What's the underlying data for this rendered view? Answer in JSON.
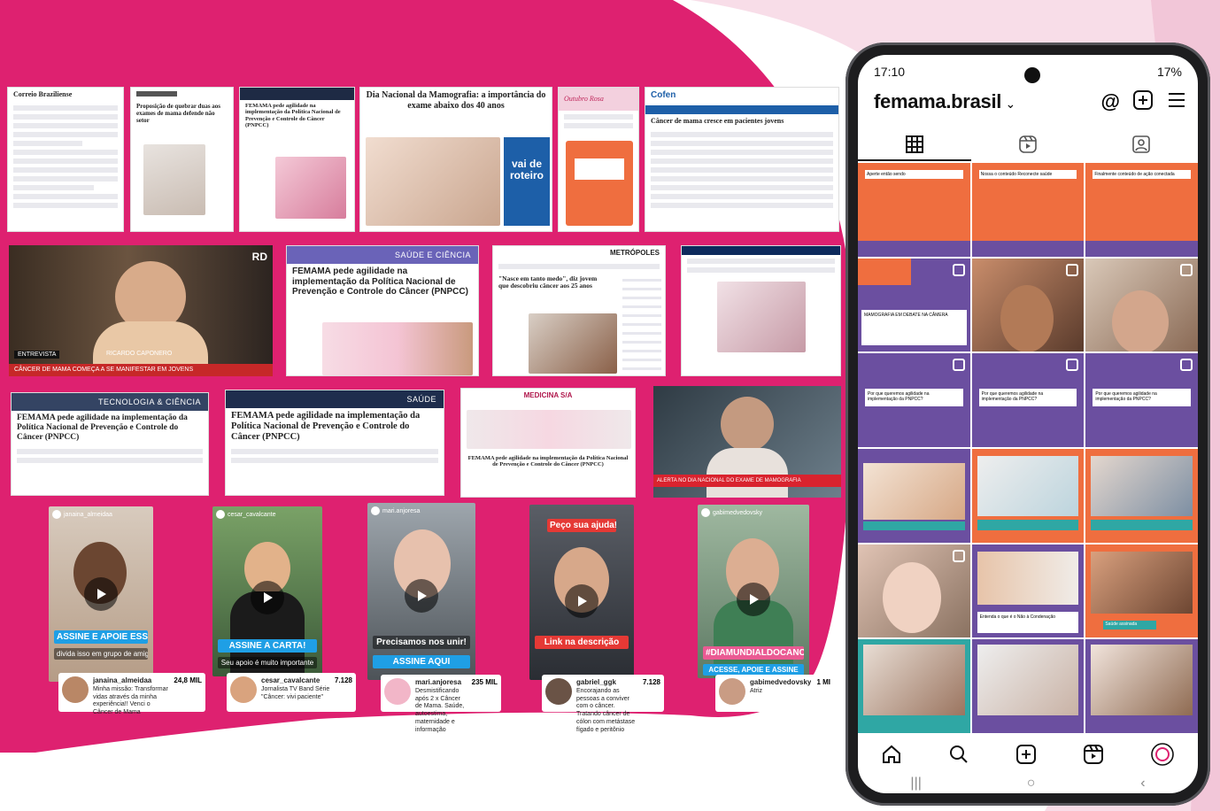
{
  "clips_top": {
    "c1_masthead": "Correio Braziliense",
    "c2_headline": "Proposição de quebrar duas aos exames de mama defende não setor",
    "c3_headline": "FEMAMA pede agilidade na implementação da Política Nacional de Prevenção e Controle do Câncer (PNPCC)",
    "c4_headline": "Dia Nacional da Mamografia: a importância do exame abaixo dos 40 anos",
    "c4_badge": "vai de roteiro",
    "c5_top": "Outubro Rosa",
    "c6_logo": "Cofen",
    "c6_headline": "Câncer de mama cresce em pacientes jovens"
  },
  "clips_mid": {
    "video1_label": "RD",
    "video1_tag": "ENTREVISTA",
    "video1_name": "RICARDO CAPONERO",
    "video1_ticker": "CÂNCER DE MAMA COMEÇA A SE MANIFESTAR EM JOVENS",
    "m2_section": "SAÚDE E CIÊNCIA",
    "m2_headline": "FEMAMA pede agilidade na implementação da Política Nacional de Prevenção e Controle do Câncer (PNPCC)",
    "m3_logo": "METRÓPOLES",
    "m3_headline": "\"Nasce em tanto medo\", diz jovem que descobriu câncer aos 25 anos"
  },
  "clips_low": {
    "l1_section": "TECNOLOGIA & CIÊNCIA",
    "l1_headline": "FEMAMA pede agilidade na implementação da Política Nacional de Prevenção e Controle do Câncer (PNPCC)",
    "l2_section": "SAÚDE",
    "l2_headline": "FEMAMA pede agilidade na implementação da Política Nacional de Prevenção e Controle do Câncer (PNPCC)",
    "l3_logo": "MEDICINA S/A",
    "l3_headline": "FEMAMA pede agilidade na implementação da Política Nacional de Prevenção e Controle do Câncer (PNPCC)",
    "l4_ticker": "ALERTA NO DIA NACIONAL DO EXAME DE MAMOGRAFIA"
  },
  "reels": [
    {
      "user": "janaina_almeidaa",
      "caption": "ASSINE E APOIE ESSA CAUSA!",
      "sub": "divida isso em grupo de amigos e família",
      "count": "24,8 MIL",
      "bio": "Minha missão: Transformar vidas através da minha experiência!! Venci o Câncer de Mama"
    },
    {
      "user": "cesar_cavalcante",
      "caption": "ASSINE A CARTA!",
      "sub": "Seu apoio é muito importante",
      "count": "7.128",
      "bio": "Jornalista TV Band Série \"Câncer: vivi paciente\""
    },
    {
      "user": "mari.anjoresa",
      "caption": "ASSINE AQUI",
      "sub": "Precisamos nos unir!",
      "count": "235 MIL",
      "bio": "Desmistificando após 2 x Câncer de Mama. Saúde, autoestima, maternidade e informação"
    },
    {
      "user": "gabriel_ggk",
      "caption": "Link na descrição",
      "sub": "Peço sua ajuda!!",
      "count": "7.128",
      "bio": "Encorajando as pessoas a conviver com o câncer. Tratando câncer de cólon com metástase fígado e peritônio"
    },
    {
      "user": "gabimedvedovsky",
      "caption": "#DIAMUNDIALDOCANCER",
      "sub": "ACESSE, APOIE E ASSINE",
      "count": "1 MI",
      "bio": "Atriz"
    }
  ],
  "phone": {
    "time": "17:10",
    "battery": "17%",
    "username": "femama.brasil",
    "grid_headlines": [
      "Aperte então sendo",
      "Nossa o conteúdo Reconecte saúde",
      "Finalmente conteúdo de ação conectada",
      "MAMOGRAFIA EM DEBATE NA CÂMERA",
      "Por que queremos agilidade na implementação da PNPCC?",
      "Entenda o que é o Não à Condenação",
      "Saúde assinada"
    ]
  },
  "colors": {
    "magenta": "#de2170",
    "pink_light": "#f8dde8",
    "purple": "#6b4fa0",
    "coral": "#ef6e3f",
    "teal": "#2fa7a4",
    "blue_caption": "#1f9fe5"
  },
  "icons": [
    "play-icon",
    "threads-icon",
    "add-post-icon",
    "menu-icon",
    "grid-icon",
    "reels-icon",
    "tagged-icon",
    "home-icon",
    "search-icon",
    "create-icon",
    "reels-nav-icon",
    "profile-icon"
  ]
}
